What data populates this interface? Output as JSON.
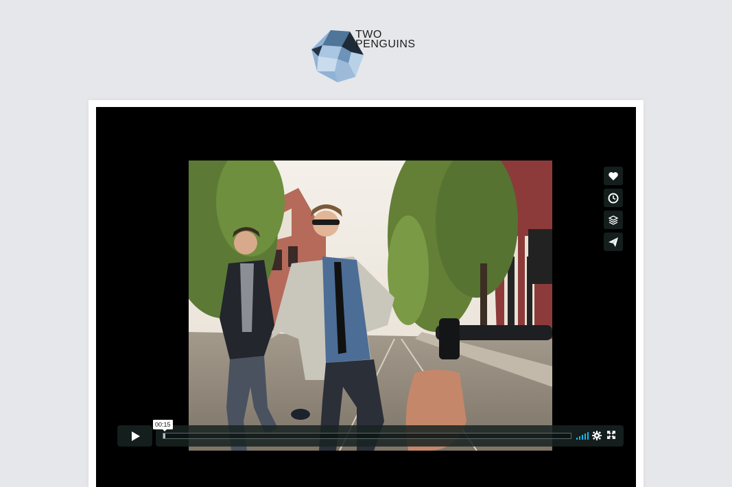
{
  "logo": {
    "line1": "TWO",
    "line2": "PENGUINS"
  },
  "player": {
    "current_time": "00:15",
    "progress": 0.005,
    "volume_bars": 5,
    "accent_color": "#1ab7ea",
    "side_actions": [
      {
        "name": "like",
        "icon": "heart-icon"
      },
      {
        "name": "watch-later",
        "icon": "clock-icon"
      },
      {
        "name": "collections",
        "icon": "layers-icon"
      },
      {
        "name": "share",
        "icon": "paper-plane-icon"
      }
    ],
    "controls": {
      "play_icon": "play-icon",
      "settings_icon": "gear-icon",
      "fullscreen_icon": "fullscreen-icon"
    }
  }
}
